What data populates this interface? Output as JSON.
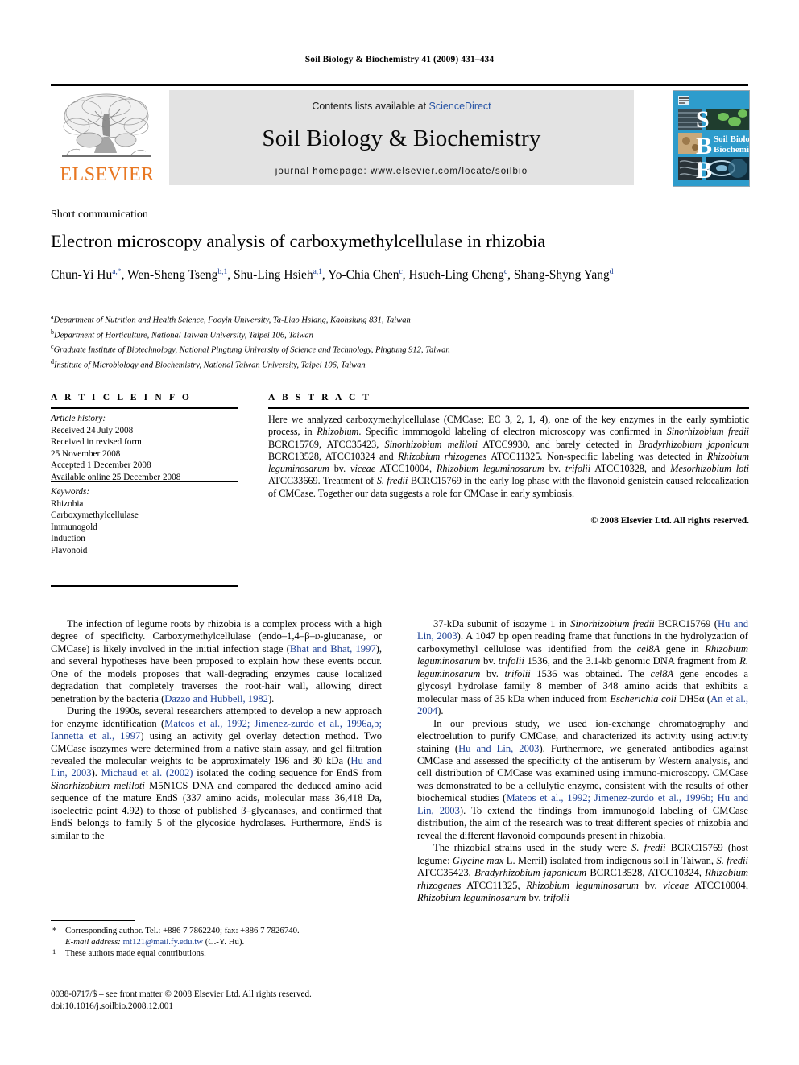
{
  "running_head": "Soil Biology & Biochemistry 41 (2009) 431–434",
  "masthead": {
    "contents_prefix": "Contents lists available at ",
    "sciencedirect": "ScienceDirect",
    "journal_name": "Soil Biology & Biochemistry",
    "homepage": "journal homepage: www.elsevier.com/locate/soilbio",
    "elsevier_wordmark": "ELSEVIER",
    "cover_title_line1": "Soil Biology &",
    "cover_title_line2": "Biochemistry",
    "cover_letters": [
      "S",
      "B",
      "B"
    ],
    "accent_orange": "#E87722",
    "link_blue": "#2552a5",
    "cover_blue": "#2e9ccc",
    "masthead_grey": "#e3e3e3"
  },
  "article": {
    "kicker": "Short communication",
    "title": "Electron microscopy analysis of carboxymethylcellulase in rhizobia",
    "authors_html": "Chun-Yi Hu<sup>a,*</sup>, Wen-Sheng Tseng<sup>b,1</sup>, Shu-Ling Hsieh<sup>a,1</sup>, Yo-Chia Chen<sup>c</sup>, Hsueh-Ling Cheng<sup>c</sup>, Shang-Shyng Yang<sup>d</sup>",
    "affiliations": [
      {
        "mark": "a",
        "text": "Department of Nutrition and Health Science, Fooyin University, Ta-Liao Hsiang, Kaohsiung 831, Taiwan"
      },
      {
        "mark": "b",
        "text": "Department of Horticulture, National Taiwan University, Taipei 106, Taiwan"
      },
      {
        "mark": "c",
        "text": "Graduate Institute of Biotechnology, National Pingtung University of Science and Technology, Pingtung 912, Taiwan"
      },
      {
        "mark": "d",
        "text": "Institute of Microbiology and Biochemistry, National Taiwan University, Taipei 106, Taiwan"
      }
    ]
  },
  "headings": {
    "article_info": "A R T I C L E  I N F O",
    "abstract": "A B S T R A C T"
  },
  "article_info": {
    "history_label": "Article history:",
    "history_lines": [
      "Received 24 July 2008",
      "Received in revised form",
      "25 November 2008",
      "Accepted 1 December 2008",
      "Available online 25 December 2008"
    ],
    "keywords_label": "Keywords:",
    "keywords": [
      "Rhizobia",
      "Carboxymethylcellulase",
      "Immunogold",
      "Induction",
      "Flavonoid"
    ]
  },
  "abstract": {
    "html": "Here we analyzed carboxymethylcellulase (CMCase; EC 3, 2, 1, 4), one of the key enzymes in the early symbiotic process, in <i>Rhizobium</i>. Specific immmogold labeling of electron microscopy was confirmed in <i>Sinorhizobium fredii</i> BCRC15769, ATCC35423, <i>Sinorhizobium meliloti</i> ATCC9930, and barely detected in <i>Bradyrhizobium japonicum</i> BCRC13528, ATCC10324 and <i>Rhizobium rhizogenes</i> ATCC11325. Non-specific labeling was detected in <i>Rhizobium leguminosarum</i> bv. <i>viceae</i> ATCC10004, <i>Rhizobium leguminosarum</i> bv. <i>trifolii</i> ATCC10328, and <i>Mesorhizobium loti</i> ATCC33669. Treatment of <i>S. fredii</i> BCRC15769 in the early log phase with the flavonoid genistein caused relocalization of CMCase. Together our data suggests a role for CMCase in early symbiosis.",
    "copyright": "© 2008 Elsevier Ltd. All rights reserved."
  },
  "body": {
    "left_column_html": [
      "The infection of legume roots by rhizobia is a complex process with a high degree of specificity. Carboxymethylcellulase (endo–1,4–β–<span style=\"font-variant:small-caps\">d</span>-glucanase, or CMCase) is likely involved in the initial infection stage (<span class=\"ref\">Bhat and Bhat, 1997</span>), and several hypotheses have been proposed to explain how these events occur. One of the models proposes that wall-degrading enzymes cause localized degradation that completely traverses the root-hair wall, allowing direct penetration by the bacteria (<span class=\"ref\">Dazzo and Hubbell, 1982</span>).",
      "During the 1990s, several researchers attempted to develop a new approach for enzyme identification (<span class=\"ref\">Mateos et al., 1992; Jimenez-zurdo et al., 1996a,b; Iannetta et al., 1997</span>) using an activity gel overlay detection method. Two CMCase isozymes were determined from a native stain assay, and gel filtration revealed the molecular weights to be approximately 196 and 30 kDa (<span class=\"ref\">Hu and Lin, 2003</span>). <span class=\"ref\">Michaud et al. (2002)</span> isolated the coding sequence for EndS from <i>Sinorhizobium meliloti</i> M5N1CS DNA and compared the deduced amino acid sequence of the mature EndS (337 amino acids, molecular mass 36,418 Da, isoelectric point 4.92) to those of published β–glycanases, and confirmed that EndS belongs to family 5 of the glycoside hydrolases. Furthermore, EndS is similar to the"
    ],
    "right_column_html": [
      "37-kDa subunit of isozyme 1 in <i>Sinorhizobium fredii</i> BCRC15769 (<span class=\"ref\">Hu and Lin, 2003</span>). A 1047 bp open reading frame that functions in the hydrolyzation of carboxymethyl cellulose was identified from the <i>cel8A</i> gene in <i>Rhizobium leguminosarum</i> bv. <i>trifolii</i> 1536, and the 3.1-kb genomic DNA fragment from <i>R. leguminosarum</i> bv. <i>trifolii</i> 1536 was obtained. The <i>cel8A</i> gene encodes a glycosyl hydrolase family 8 member of 348 amino acids that exhibits a molecular mass of 35 kDa when induced from <i>Escherichia coli</i> DH5α (<span class=\"ref\">An et al., 2004</span>).",
      "In our previous study, we used ion-exchange chromatography and electroelution to purify CMCase, and characterized its activity using activity staining (<span class=\"ref\">Hu and Lin, 2003</span>). Furthermore, we generated antibodies against CMCase and assessed the specificity of the antiserum by Western analysis, and cell distribution of CMCase was examined using immuno-microscopy. CMCase was demonstrated to be a cellulytic enzyme, consistent with the results of other biochemical studies (<span class=\"ref\">Mateos et al., 1992; Jimenez-zurdo et al., 1996b; Hu and Lin, 2003</span>). To extend the findings from immunogold labeling of CMCase distribution, the aim of the research was to treat different species of rhizobia and reveal the different flavonoid compounds present in rhizobia.",
      "The rhizobial strains used in the study were <i>S. fredii</i> BCRC15769 (host legume: <i>Glycine max</i> L. Merril) isolated from indigenous soil in Taiwan, <i>S. fredii</i> ATCC35423, <i>Bradyrhizobium japonicum</i> BCRC13528, ATCC10324, <i>Rhizobium rhizogenes</i> ATCC11325, <i>Rhizobium leguminosarum</i> bv. <i>viceae</i> ATCC10004, <i>Rhizobium leguminosarum</i> bv. <i>trifolii</i>"
    ]
  },
  "footnotes": {
    "corresponding_mark": "*",
    "corresponding_text": "Corresponding author. Tel.: +886 7 7862240; fax: +886 7 7826740.",
    "email_label": "E-mail address:",
    "email": "mt121@mail.fy.edu.tw",
    "email_suffix": "(C.-Y. Hu).",
    "equal_mark": "1",
    "equal_text": "These authors made equal contributions."
  },
  "imprint": {
    "line1": "0038-0717/$ – see front matter © 2008 Elsevier Ltd. All rights reserved.",
    "line2": "doi:10.1016/j.soilbio.2008.12.001"
  }
}
